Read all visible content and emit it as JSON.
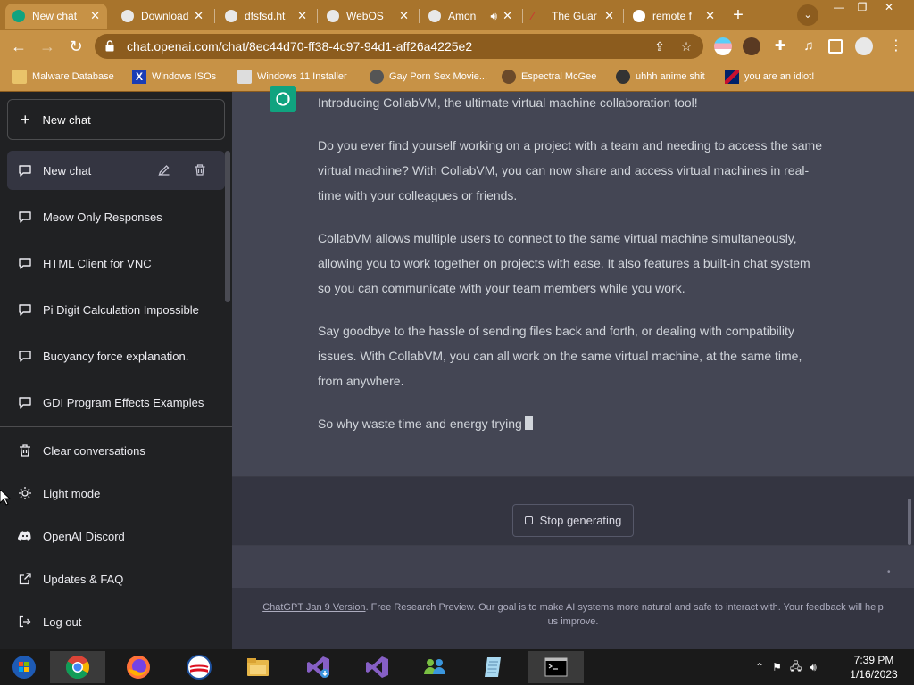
{
  "browser": {
    "tabs": [
      {
        "label": "New chat",
        "active": true,
        "icon": "chatgpt-icon"
      },
      {
        "label": "Download",
        "active": false,
        "icon": "globe-icon"
      },
      {
        "label": "dfsfsd.ht",
        "active": false,
        "icon": "globe-icon"
      },
      {
        "label": "WebOS",
        "active": false,
        "icon": "globe-icon"
      },
      {
        "label": "Amon",
        "active": false,
        "icon": "globe-icon",
        "audio": true
      },
      {
        "label": "The Guar",
        "active": false,
        "icon": "guardian-icon"
      },
      {
        "label": "remote f",
        "active": false,
        "icon": "google-icon"
      }
    ],
    "url": "chat.openai.com/chat/8ec44d70-ff38-4c97-94d1-aff26a4225e2",
    "bookmarks": [
      {
        "label": "Malware Database",
        "icon": "folder-icon"
      },
      {
        "label": "Windows ISOs",
        "icon": "x-icon"
      },
      {
        "label": "Windows 11 Installer",
        "icon": "image-icon"
      },
      {
        "label": "Gay Porn Sex Movie...",
        "icon": "bookmark-icon"
      },
      {
        "label": "Espectral McGee",
        "icon": "bookmark-icon"
      },
      {
        "label": "uhhh anime shit",
        "icon": "bookmark-icon"
      },
      {
        "label": "you are an idiot!",
        "icon": "flag-icon"
      }
    ],
    "colors": {
      "frame": "#a8742c",
      "toolbar": "#c79246",
      "omnibox": "#8c5c1e"
    }
  },
  "sidebar": {
    "new_chat_label": "New chat",
    "conversations": [
      {
        "label": "New chat",
        "active": true
      },
      {
        "label": "Meow Only Responses"
      },
      {
        "label": "HTML Client for VNC"
      },
      {
        "label": "Pi Digit Calculation Impossible"
      },
      {
        "label": "Buoyancy force explanation."
      },
      {
        "label": "GDI Program Effects Examples"
      }
    ],
    "bottom_items": [
      {
        "label": "Clear conversations",
        "icon": "trash-icon"
      },
      {
        "label": "Light mode",
        "icon": "sun-icon"
      },
      {
        "label": "OpenAI Discord",
        "icon": "discord-icon"
      },
      {
        "label": "Updates & FAQ",
        "icon": "external-link-icon"
      },
      {
        "label": "Log out",
        "icon": "logout-icon"
      }
    ]
  },
  "chat": {
    "paragraphs": [
      "Introducing CollabVM, the ultimate virtual machine collaboration tool!",
      "Do you ever find yourself working on a project with a team and needing to access the same virtual machine? With CollabVM, you can now share and access virtual machines in real-time with your colleagues or friends.",
      "CollabVM allows multiple users to connect to the same virtual machine simultaneously, allowing you to work together on projects with ease. It also features a built-in chat system so you can communicate with your team members while you work.",
      "Say goodbye to the hassle of sending files back and forth, or dealing with compatibility issues. With CollabVM, you can all work on the same virtual machine, at the same time, from anywhere.",
      "So why waste time and energy trying"
    ],
    "stop_label": "Stop generating",
    "footer_link": "ChatGPT Jan 9 Version",
    "footer_text": ". Free Research Preview. Our goal is to make AI systems more natural and safe to interact with. Your feedback will help us improve.",
    "colors": {
      "sidebar": "#202123",
      "main": "#343541",
      "message": "#444654",
      "accent": "#10a37f"
    }
  },
  "taskbar": {
    "apps": [
      "chrome-icon",
      "firefox-icon",
      "obama-icon",
      "file-explorer-icon",
      "visual-studio-installer-icon",
      "visual-studio-icon",
      "network-people-icon",
      "notepad-icon",
      "command-prompt-icon"
    ],
    "time": "7:39 PM",
    "date": "1/16/2023"
  }
}
